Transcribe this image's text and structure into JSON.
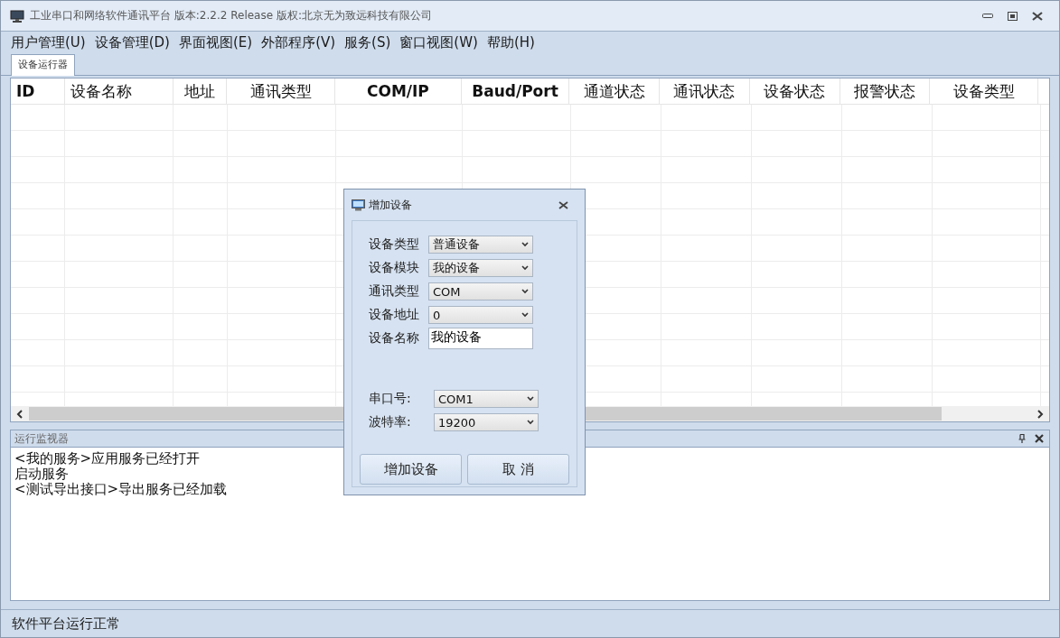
{
  "window": {
    "title": "工业串口和网络软件通讯平台 版本:2.2.2 Release 版权:北京无为致远科技有限公司"
  },
  "menu": [
    "用户管理(U)",
    "设备管理(D)",
    "界面视图(E)",
    "外部程序(V)",
    "服务(S)",
    "窗口视图(W)",
    "帮助(H)"
  ],
  "tabs": [
    {
      "label": "设备运行器",
      "selected": true
    }
  ],
  "table": {
    "columns": [
      {
        "label": "ID",
        "bold": true
      },
      {
        "label": "设备名称",
        "bold": false
      },
      {
        "label": "地址",
        "bold": false
      },
      {
        "label": "通讯类型",
        "bold": false
      },
      {
        "label": "COM/IP",
        "bold": true
      },
      {
        "label": "Baud/Port",
        "bold": true
      },
      {
        "label": "通道状态",
        "bold": false
      },
      {
        "label": "通讯状态",
        "bold": false
      },
      {
        "label": "设备状态",
        "bold": false
      },
      {
        "label": "报警状态",
        "bold": false
      },
      {
        "label": "设备类型",
        "bold": false
      }
    ]
  },
  "monitor": {
    "title": "运行监视器",
    "lines": [
      "<我的服务>应用服务已经打开",
      "启动服务",
      "<测试导出接口>导出服务已经加载"
    ]
  },
  "status_bar": "软件平台运行正常",
  "dialog": {
    "title": "增加设备",
    "device_fields": [
      {
        "label": "设备类型",
        "value": "普通设备",
        "kind": "select"
      },
      {
        "label": "设备模块",
        "value": "我的设备",
        "kind": "select"
      },
      {
        "label": "通讯类型",
        "value": "COM",
        "kind": "select"
      },
      {
        "label": "设备地址",
        "value": "0",
        "kind": "select"
      },
      {
        "label": "设备名称",
        "value": "我的设备",
        "kind": "text"
      }
    ],
    "port_fields": [
      {
        "label": "串口号:",
        "value": "COM1",
        "kind": "select"
      },
      {
        "label": "波特率:",
        "value": "19200",
        "kind": "select"
      }
    ],
    "buttons": [
      "增加设备",
      "取 消"
    ]
  }
}
